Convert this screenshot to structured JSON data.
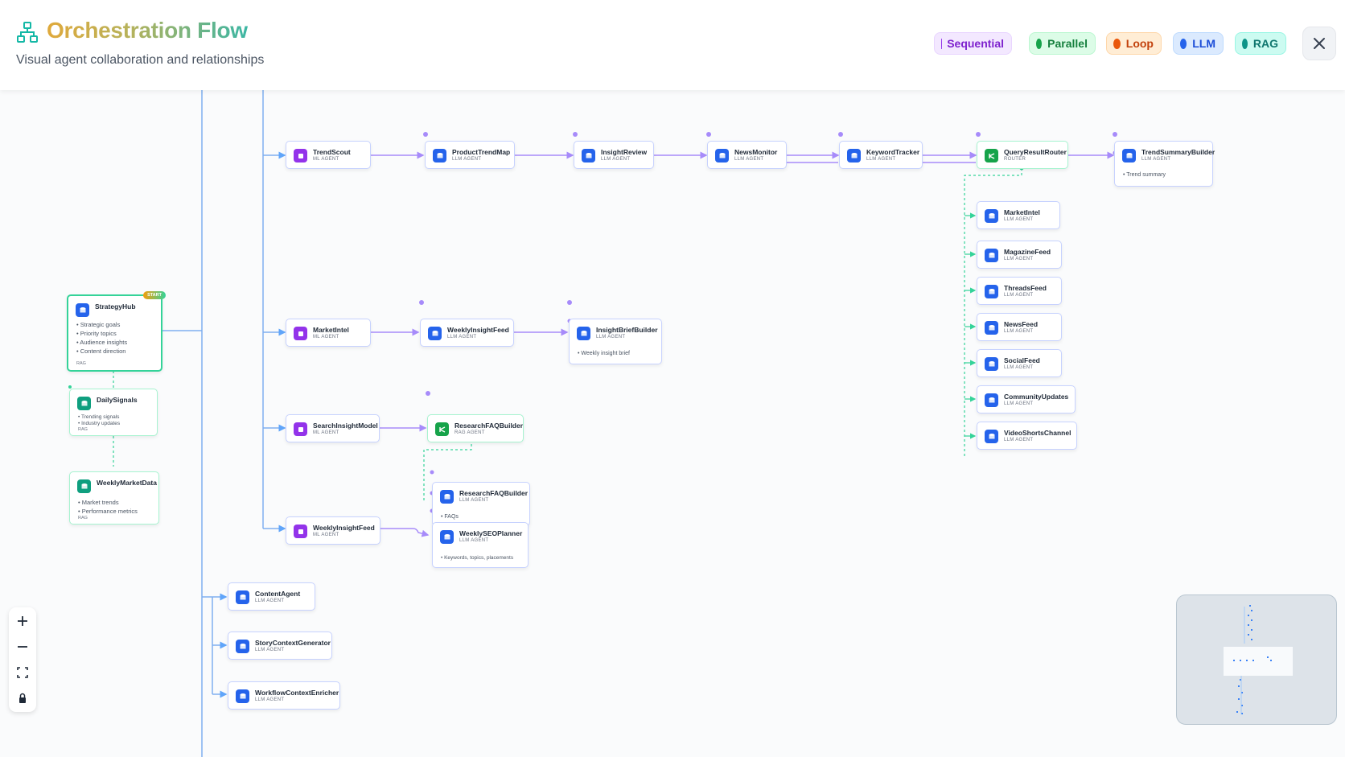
{
  "header": {
    "title": "Orchestration Flow",
    "subtitle": "Visual agent collaboration and relationships",
    "legend": [
      {
        "label": "Sequential",
        "dot": "#9333ea",
        "bg": "#f3e8ff",
        "border": "#e9d5ff",
        "text": "#7e22ce"
      },
      {
        "label": "Parallel",
        "dot": "#16a34a",
        "bg": "#dcfce7",
        "border": "#bbf7d0",
        "text": "#15803d"
      },
      {
        "label": "Loop",
        "dot": "#ea580c",
        "bg": "#ffedd5",
        "border": "#fed7aa",
        "text": "#c2410c"
      },
      {
        "label": "LLM",
        "dot": "#2563eb",
        "bg": "#dbeafe",
        "border": "#bfdbfe",
        "text": "#1d4ed8"
      },
      {
        "label": "RAG",
        "dot": "#0d9488",
        "bg": "#ccfbf1",
        "border": "#99f6e4",
        "text": "#0f766e"
      }
    ]
  },
  "nodes": {
    "strategyhub": {
      "title": "StrategyHub",
      "badge": "START",
      "bullets": [
        "Strategic goals",
        "Priority topics",
        "Audience insights",
        "Content direction"
      ],
      "tag": "RAG"
    },
    "dailysignals": {
      "title": "DailySignals",
      "bullets": [
        "Trending signals",
        "Industry updates"
      ],
      "tag": "RAG"
    },
    "weeklymarketdata": {
      "title": "WeeklyMarketData",
      "bullets": [
        "Market trends",
        "Performance metrics"
      ],
      "tag": "RAG"
    },
    "trendscout": {
      "title": "TrendScout",
      "sub": "ML AGENT"
    },
    "producttrendmap": {
      "title": "ProductTrendMap",
      "sub": "LLM AGENT"
    },
    "insightreview": {
      "title": "InsightReview",
      "sub": "LLM AGENT"
    },
    "newsmonitor": {
      "title": "NewsMonitor",
      "sub": "LLM AGENT"
    },
    "keywordtracker": {
      "title": "KeywordTracker",
      "sub": "LLM AGENT"
    },
    "queryresultrouter": {
      "title": "QueryResultRouter",
      "sub": "ROUTER"
    },
    "trendsummarybuilder": {
      "title": "TrendSummaryBuilder",
      "sub": "LLM AGENT",
      "bullets": [
        "Trend summary"
      ]
    },
    "marketintel_r": {
      "title": "MarketIntel",
      "sub": "LLM AGENT"
    },
    "magazinefeed": {
      "title": "MagazineFeed",
      "sub": "LLM AGENT"
    },
    "threadsfeed": {
      "title": "ThreadsFeed",
      "sub": "LLM AGENT"
    },
    "newsfeed": {
      "title": "NewsFeed",
      "sub": "LLM AGENT"
    },
    "socialfeed": {
      "title": "SocialFeed",
      "sub": "LLM AGENT"
    },
    "communityupdates": {
      "title": "CommunityUpdates",
      "sub": "LLM AGENT"
    },
    "videoshortschannel": {
      "title": "VideoShortsChannel",
      "sub": "LLM AGENT"
    },
    "marketintel": {
      "title": "MarketIntel",
      "sub": "ML AGENT"
    },
    "weeklyinsightfeed": {
      "title": "WeeklyInsightFeed",
      "sub": "LLM AGENT"
    },
    "insightbriefbuilder": {
      "title": "InsightBriefBuilder",
      "sub": "LLM AGENT",
      "bullets": [
        "Weekly insight brief"
      ]
    },
    "searchinsightmodel": {
      "title": "SearchInsightModel",
      "sub": "ML AGENT"
    },
    "researchfaqbuilder_rag": {
      "title": "ResearchFAQBuilder",
      "sub": "RAG AGENT"
    },
    "researchfaqbuilder": {
      "title": "ResearchFAQBuilder",
      "sub": "LLM AGENT",
      "bullets": [
        "FAQs"
      ]
    },
    "weeklyinsightfeed_ml": {
      "title": "WeeklyInsightFeed",
      "sub": "ML AGENT"
    },
    "weeklyseoplanner": {
      "title": "WeeklySEOPlanner",
      "sub": "LLM AGENT",
      "bullets": [
        "Keywords, topics, placements"
      ]
    },
    "contentagent": {
      "title": "ContentAgent",
      "sub": "LLM AGENT"
    },
    "storycontextgenerator": {
      "title": "StoryContextGenerator",
      "sub": "LLM AGENT"
    },
    "workflowcontextenricher": {
      "title": "WorkflowContextEnricher",
      "sub": "LLM AGENT"
    }
  }
}
